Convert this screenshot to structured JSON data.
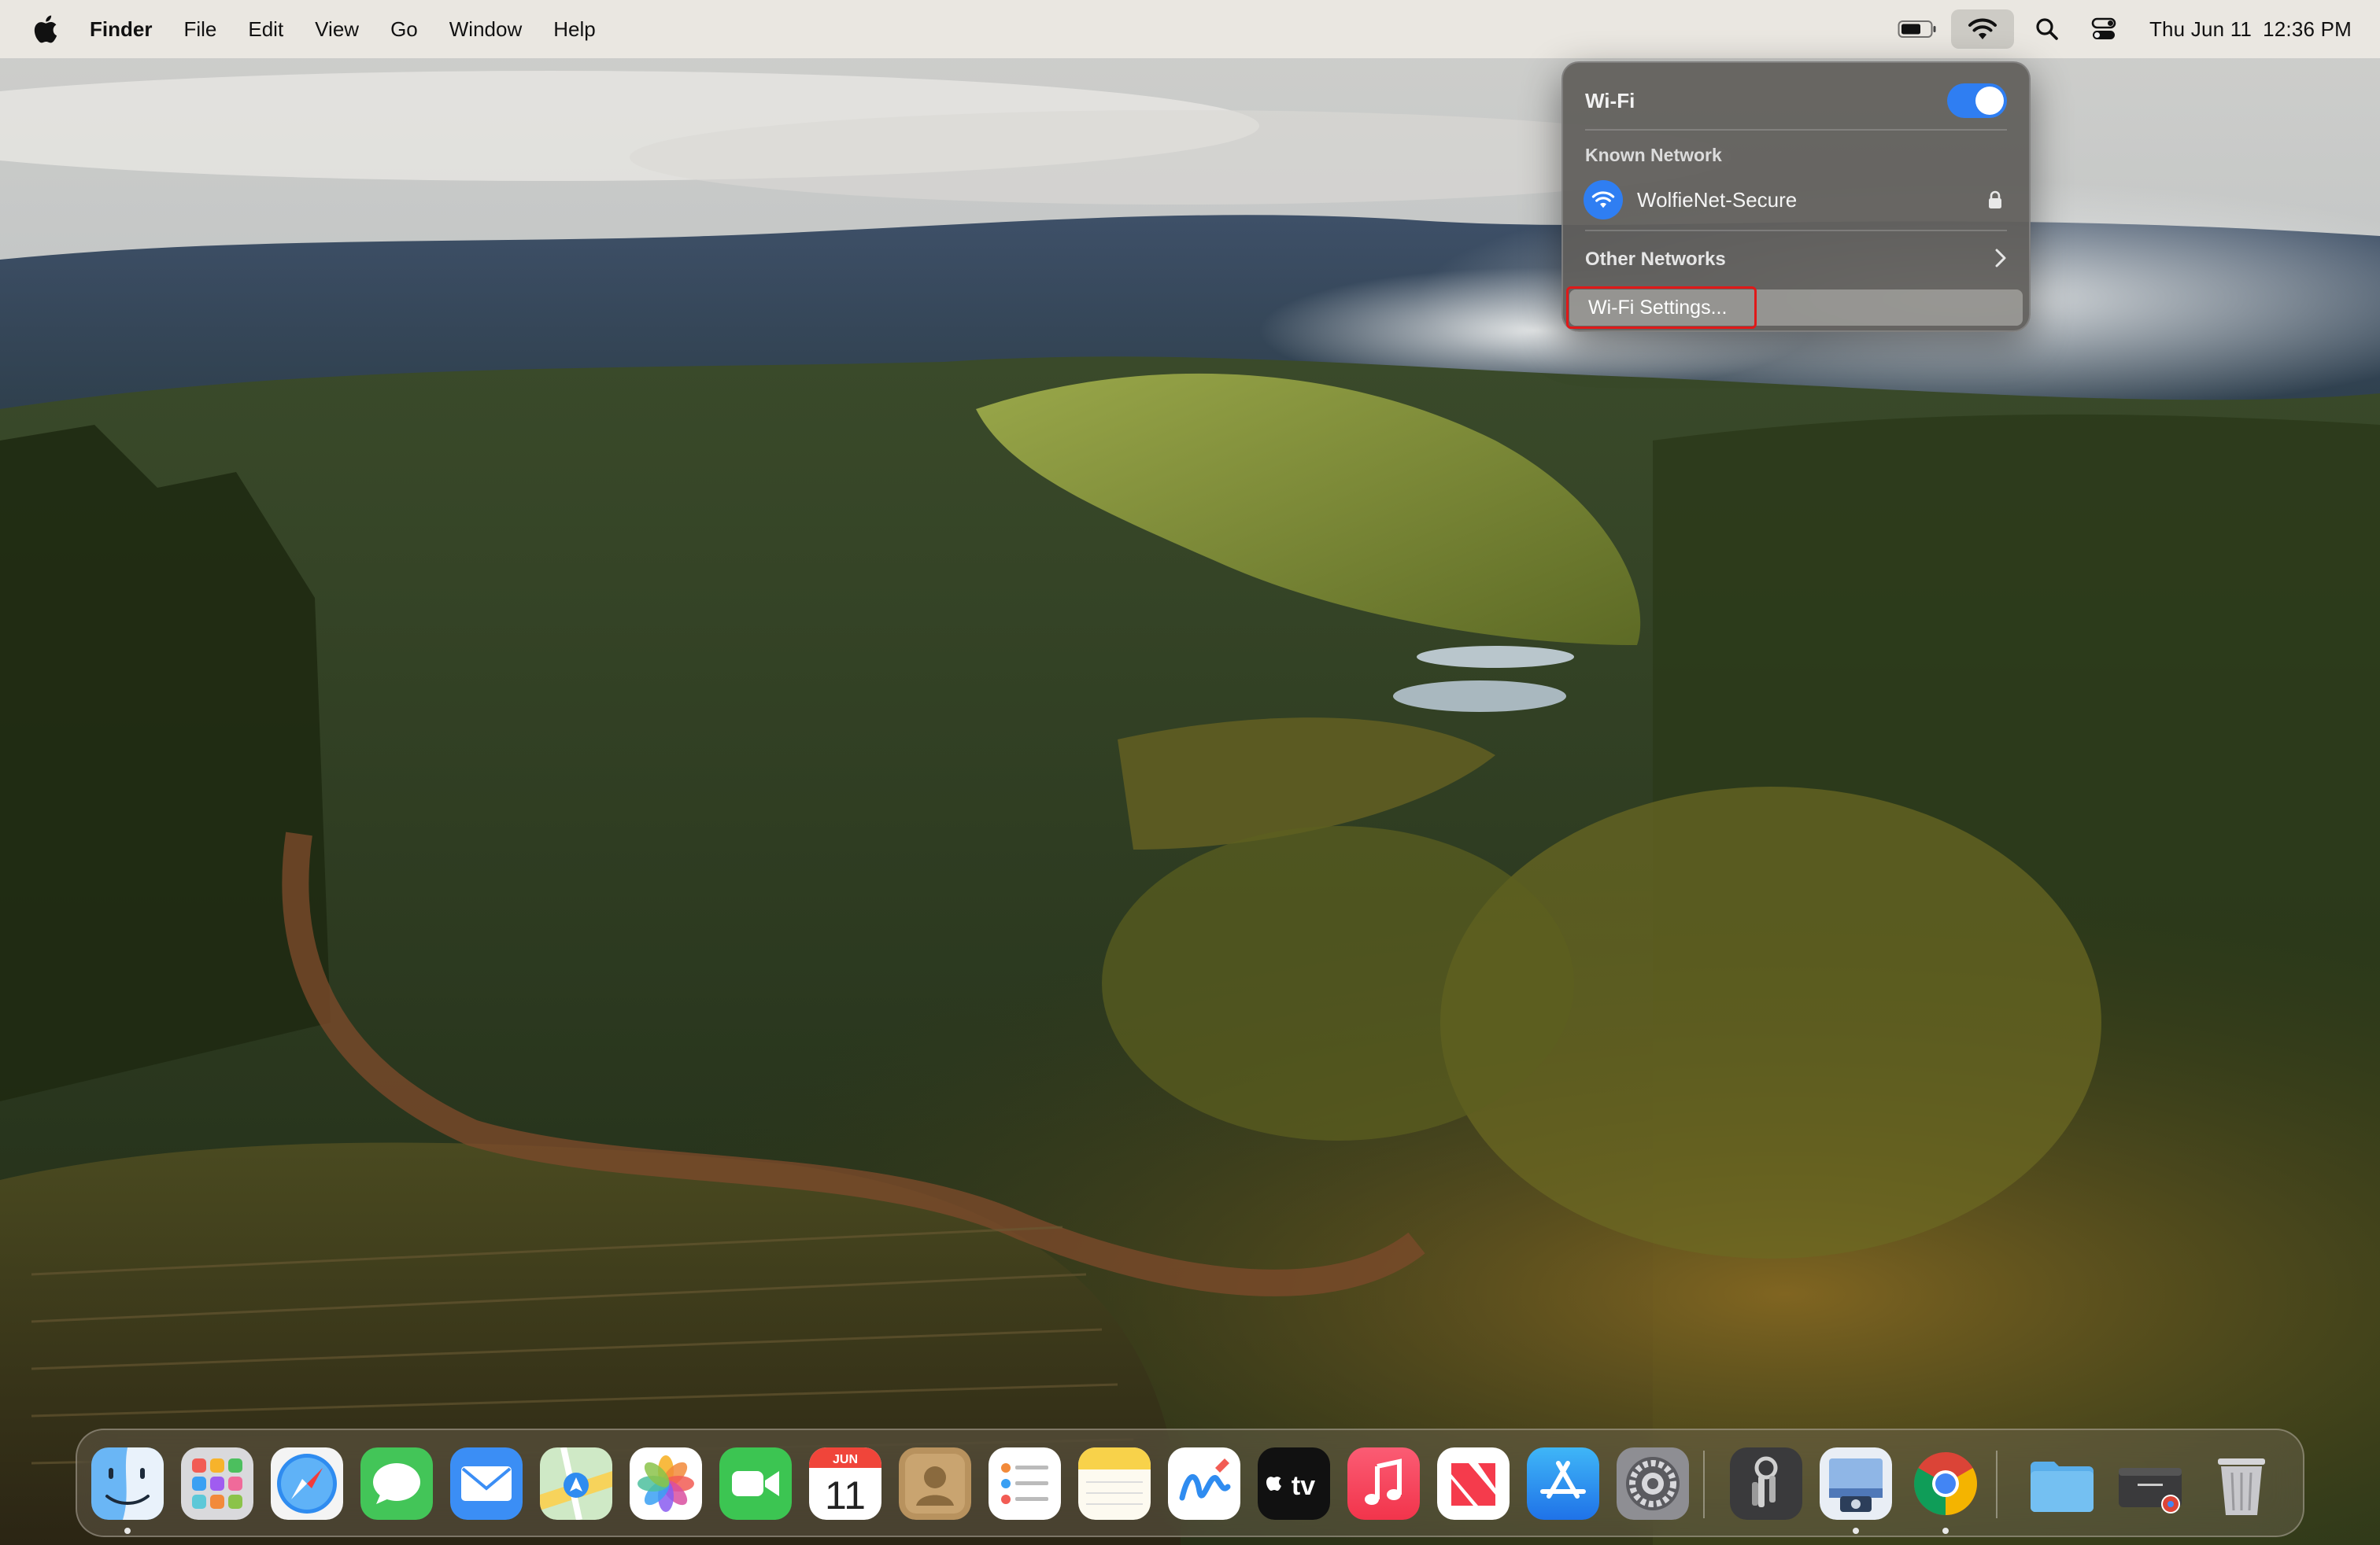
{
  "menubar": {
    "app_name": "Finder",
    "items": [
      "File",
      "Edit",
      "View",
      "Go",
      "Window",
      "Help"
    ],
    "clock": {
      "day": "Thu Jun 11",
      "time": "12:36 PM"
    }
  },
  "wifi_panel": {
    "title": "Wi-Fi",
    "enabled": true,
    "known_network_label": "Known Network",
    "known_network": {
      "name": "WolfieNet-Secure",
      "secured": true
    },
    "other_networks_label": "Other Networks",
    "settings_label": "Wi-Fi Settings..."
  },
  "dock": {
    "apps": [
      {
        "id": "finder",
        "running": true
      },
      {
        "id": "launchpad"
      },
      {
        "id": "safari"
      },
      {
        "id": "messages"
      },
      {
        "id": "mail"
      },
      {
        "id": "maps"
      },
      {
        "id": "photos"
      },
      {
        "id": "facetime"
      },
      {
        "id": "calendar",
        "month": "JUN",
        "day": "11"
      },
      {
        "id": "contacts"
      },
      {
        "id": "reminders"
      },
      {
        "id": "notes"
      },
      {
        "id": "freeform"
      },
      {
        "id": "tv",
        "label": "tv"
      },
      {
        "id": "music"
      },
      {
        "id": "news"
      },
      {
        "id": "app-store"
      },
      {
        "id": "system-settings"
      },
      {
        "id": "keychain-access"
      },
      {
        "id": "preview",
        "running": true
      },
      {
        "id": "chrome",
        "running": true
      },
      {
        "id": "downloads-folder"
      },
      {
        "id": "chrome-app-window"
      },
      {
        "id": "trash"
      }
    ]
  },
  "colors": {
    "accent_blue": "#2f7ef2",
    "highlight_red": "#e01919"
  }
}
